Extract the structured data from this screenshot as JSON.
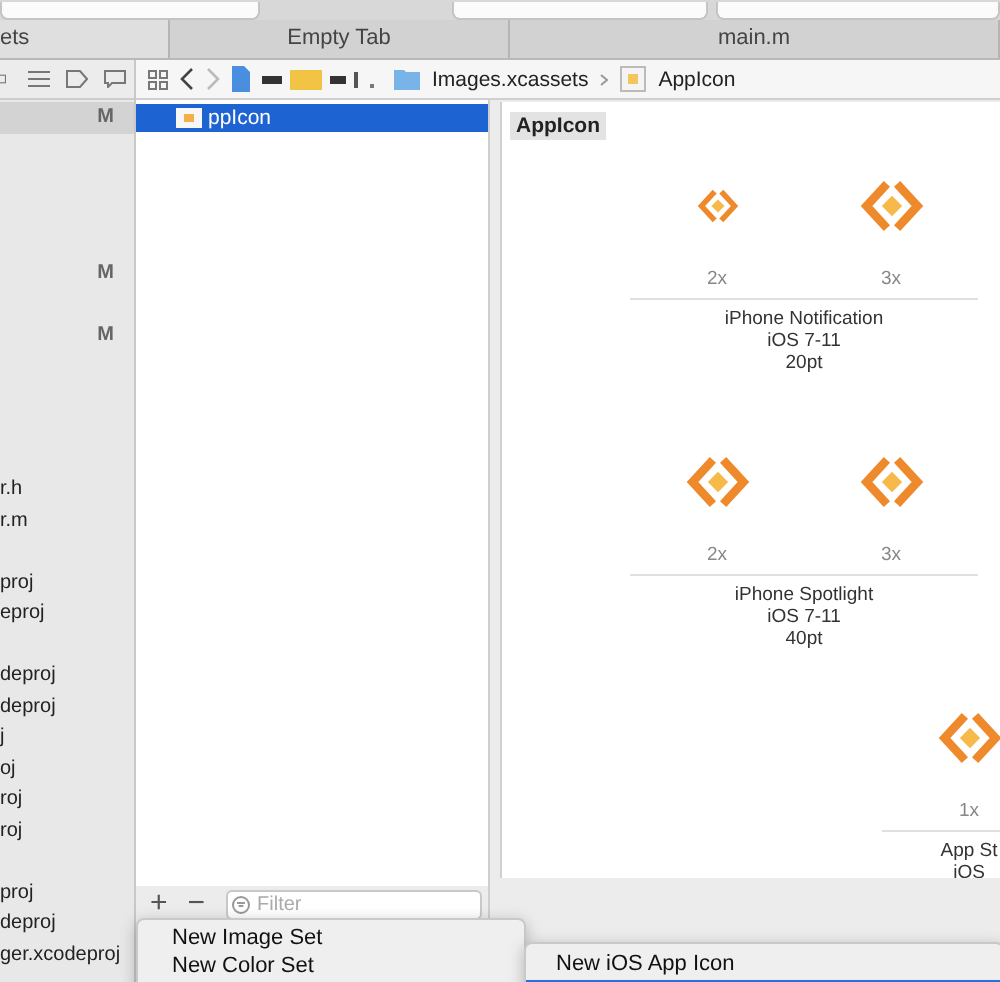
{
  "tabs": [
    {
      "label": "ets",
      "selected": true
    },
    {
      "label": "Empty Tab",
      "selected": false
    },
    {
      "label": "main.m",
      "selected": false
    }
  ],
  "navigator": {
    "rows": [
      {
        "badge": "M",
        "selected": true
      },
      {
        "badge": "M",
        "selected": false
      },
      {
        "badge": "M",
        "selected": false
      },
      {
        "label": "r.h",
        "selected": false
      },
      {
        "label": "r.m",
        "selected": false
      },
      {
        "label": "proj",
        "selected": false
      },
      {
        "label": "eproj",
        "selected": false
      },
      {
        "label": "deproj",
        "selected": false
      },
      {
        "label": "deproj",
        "selected": false
      },
      {
        "label": "j",
        "selected": false
      },
      {
        "label": "oj",
        "selected": false
      },
      {
        "label": "roj",
        "selected": false
      },
      {
        "label": "roj",
        "selected": false
      },
      {
        "label": "proj",
        "selected": false
      },
      {
        "label": "deproj",
        "selected": false
      },
      {
        "label": "ger.xcodeproj",
        "selected": false
      }
    ]
  },
  "jump_bar": {
    "path": [
      {
        "label": "Images.xcassets",
        "kind": "folder"
      },
      {
        "label": "AppIcon",
        "kind": "appicon"
      }
    ]
  },
  "asset_list": {
    "items": [
      {
        "label": "ppIcon",
        "selected": true
      }
    ],
    "buttons": [
      "+",
      "−"
    ],
    "filter": {
      "placeholder": "Filter"
    }
  },
  "canvas": {
    "title": "AppIcon",
    "groups": [
      {
        "lines": [
          "iPhone Notification",
          "iOS 7-11",
          "20pt"
        ],
        "slots": [
          "2x",
          "3x"
        ]
      },
      {
        "lines": [
          "iPhone Spotlight",
          "iOS 7-11",
          "40pt"
        ],
        "slots": [
          "2x",
          "3x"
        ]
      },
      {
        "lines": [
          "App St",
          "iOS"
        ],
        "slots": [
          "1x"
        ]
      }
    ]
  },
  "context_menu": {
    "items": [
      {
        "label": "New Image Set"
      },
      {
        "label": "New Color Set"
      }
    ]
  },
  "submenu": {
    "items": [
      {
        "label": "New iOS App Icon",
        "selected": false
      },
      {
        "selected": true
      }
    ]
  }
}
